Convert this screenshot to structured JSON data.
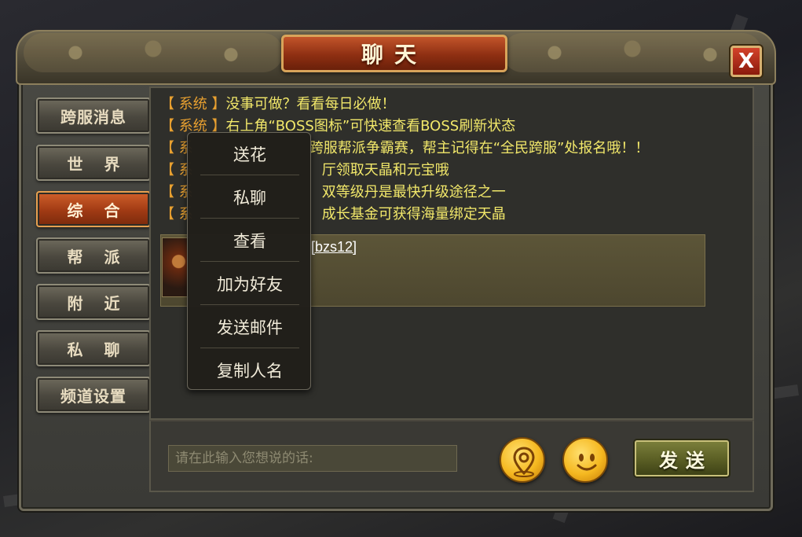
{
  "window": {
    "title": "聊天",
    "close_label": "X"
  },
  "sidebar": {
    "items": [
      {
        "label": "跨服消息"
      },
      {
        "label": "世 界"
      },
      {
        "label": "综 合"
      },
      {
        "label": "帮 派"
      },
      {
        "label": "附 近"
      },
      {
        "label": "私 聊"
      },
      {
        "label": "频道设置"
      }
    ],
    "active": "综 合"
  },
  "messages": [
    {
      "tag": "【 系统 】",
      "text": "没事可做？看看每日必做！"
    },
    {
      "tag": "【 系统 】",
      "text": "右上角“BOSS图标”可快速查看BOSS刷新状态"
    },
    {
      "tag": "【 系",
      "text": "跨服帮派争霸赛，帮主记得在“全民跨服”处报名哦！！"
    },
    {
      "tag": "【 系",
      "text": "厅领取天晶和元宝哦"
    },
    {
      "tag": "【 系",
      "text": "双等级丹是最快升级途径之一"
    },
    {
      "tag": "【 系",
      "text": "成长基金可获得海量绑定天晶"
    }
  ],
  "player": {
    "name": "[bzs12]"
  },
  "context_menu": {
    "items": [
      {
        "label": "送花"
      },
      {
        "label": "私聊"
      },
      {
        "label": "查看"
      },
      {
        "label": "加为好友"
      },
      {
        "label": "发送邮件"
      },
      {
        "label": "复制人名"
      }
    ]
  },
  "input": {
    "placeholder": "请在此输入您想说的话:"
  },
  "buttons": {
    "send_label": "发送"
  },
  "colors": {
    "system_tag": "#e8a030",
    "message_text": "#f2e86a",
    "active_tab": "#c2542a"
  }
}
